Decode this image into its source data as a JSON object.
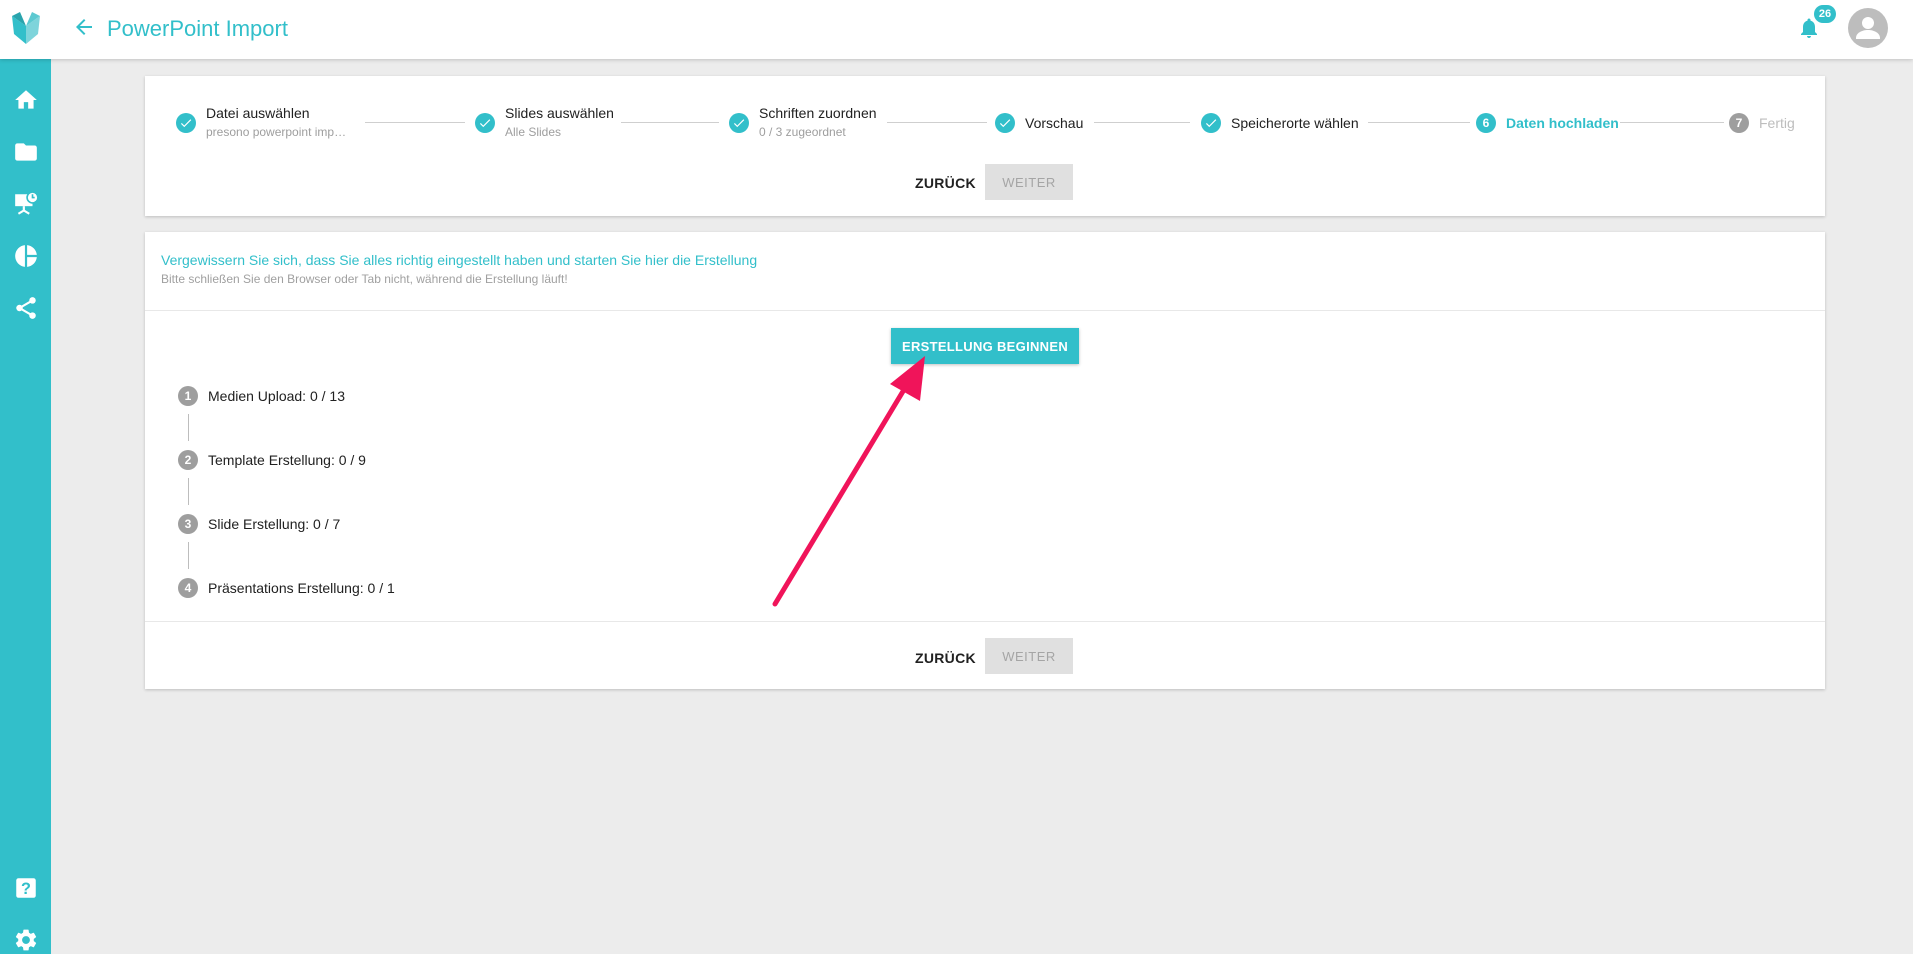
{
  "app": {
    "title": "PowerPoint Import",
    "notification_count": "26",
    "accent_color": "#32bfca"
  },
  "sidebar": {
    "items": [
      {
        "name": "home-icon"
      },
      {
        "name": "folder-icon"
      },
      {
        "name": "presentation-icon"
      },
      {
        "name": "pie-chart-icon"
      },
      {
        "name": "share-icon"
      },
      {
        "name": "help-icon"
      },
      {
        "name": "gear-icon"
      }
    ]
  },
  "stepper": {
    "steps": [
      {
        "label": "Datei auswählen",
        "sub": "presono powerpoint imp…",
        "state": "done"
      },
      {
        "label": "Slides auswählen",
        "sub": "Alle Slides",
        "state": "done"
      },
      {
        "label": "Schriften zuordnen",
        "sub": "0 / 3 zugeordnet",
        "state": "done"
      },
      {
        "label": "Vorschau",
        "state": "done"
      },
      {
        "label": "Speicherorte wählen",
        "state": "done"
      },
      {
        "label": "Daten hochladen",
        "number": "6",
        "state": "active"
      },
      {
        "label": "Fertig",
        "number": "7",
        "state": "todo"
      }
    ],
    "back_label": "ZURÜCK",
    "next_label": "WEITER"
  },
  "main": {
    "info_title": "Vergewissern Sie sich, dass Sie alles richtig eingestellt haben und starten Sie hier die Erstellung",
    "info_sub": "Bitte schließen Sie den Browser oder Tab nicht, während die Erstellung läuft!",
    "start_button": "ERSTELLUNG BEGINNEN",
    "progress": [
      {
        "number": "1",
        "label": "Medien Upload: 0 / 13"
      },
      {
        "number": "2",
        "label": "Template Erstellung: 0 / 9"
      },
      {
        "number": "3",
        "label": "Slide Erstellung: 0 / 7"
      },
      {
        "number": "4",
        "label": "Präsentations Erstellung: 0 / 1"
      }
    ],
    "back_label": "ZURÜCK",
    "next_label": "WEITER"
  },
  "annotation": {
    "arrow_color": "#f0145a"
  }
}
